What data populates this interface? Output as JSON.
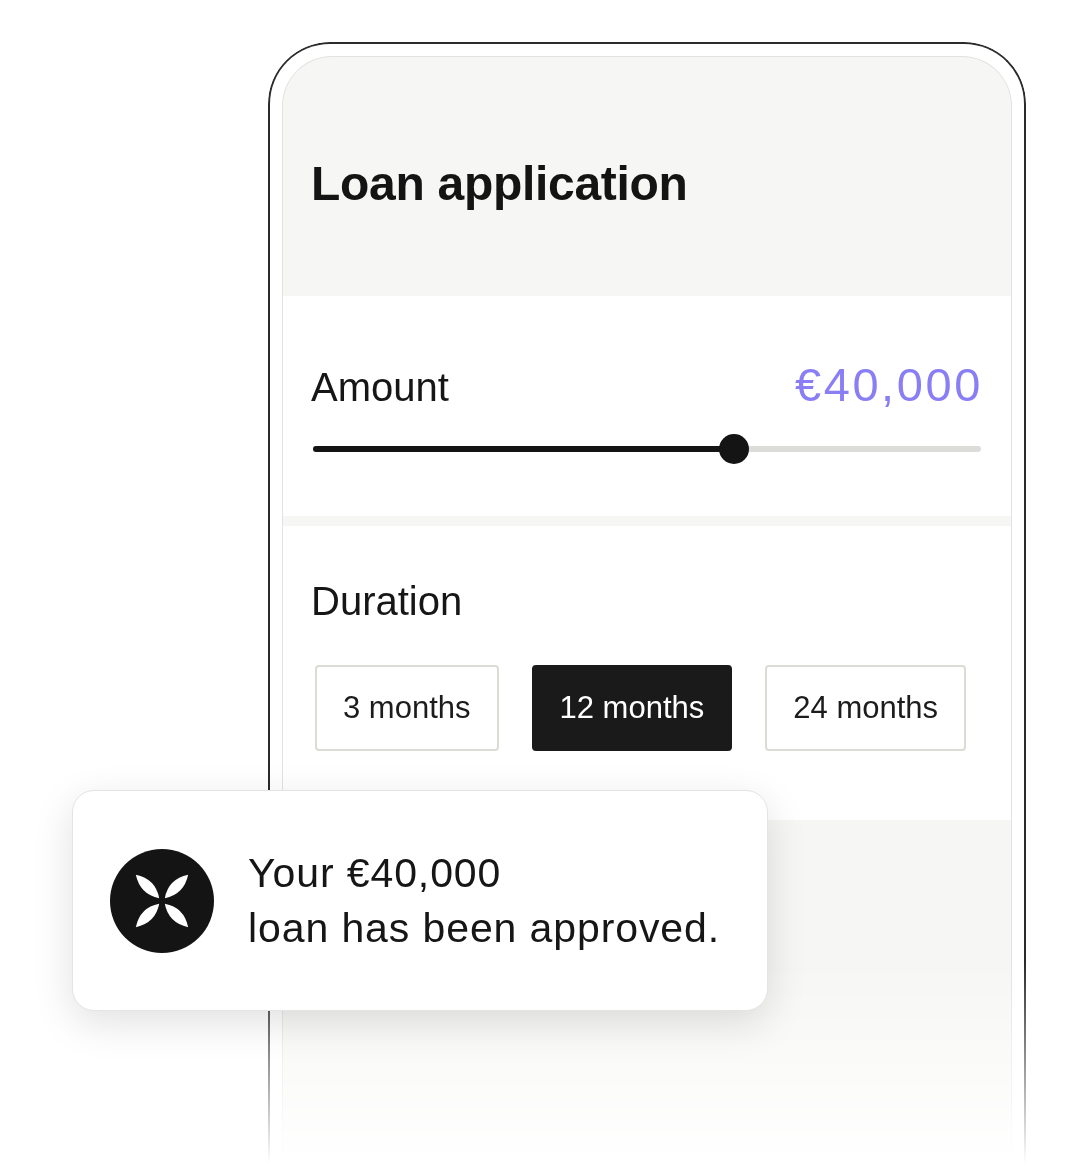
{
  "screen": {
    "title": "Loan application"
  },
  "amount": {
    "label": "Amount",
    "value": "€40,000",
    "slider": {
      "level": 0.63
    }
  },
  "duration": {
    "label": "Duration",
    "options": [
      {
        "label": "3 months",
        "selected": false
      },
      {
        "label": "12 months",
        "selected": true
      },
      {
        "label": "24 months",
        "selected": false
      }
    ]
  },
  "toast": {
    "message": "Your €40,000\nloan has been approved."
  }
}
